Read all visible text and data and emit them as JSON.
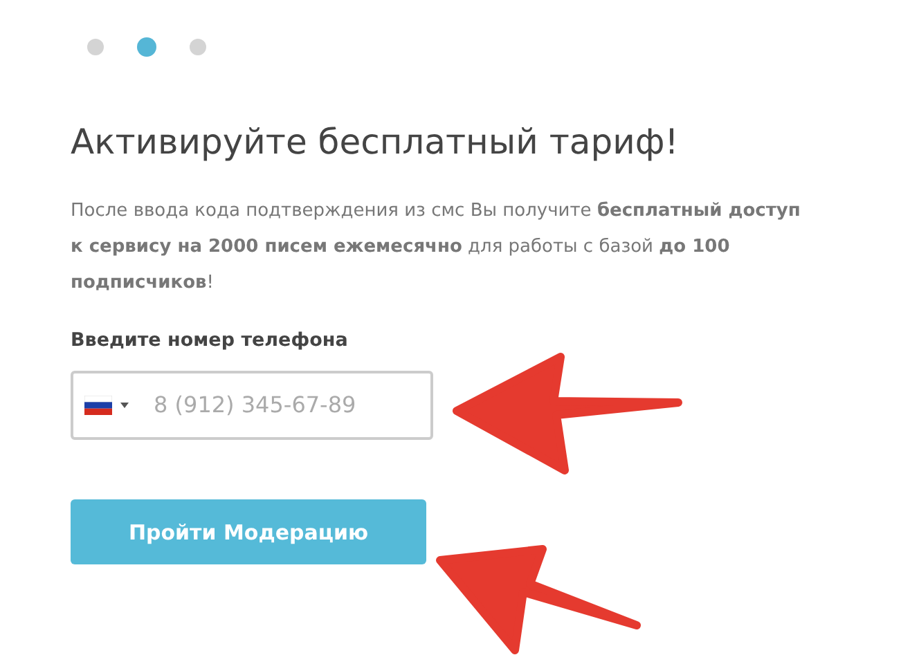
{
  "steps": [
    {
      "selected": false
    },
    {
      "selected": true
    },
    {
      "selected": false
    }
  ],
  "title": "Активируйте бесплатный тариф!",
  "description": "После ввода кода подтверждения из смс Вы получите **бесплатный доступ к сервису на 2000 писем ежемесячно** для работы с базой **до 100 подписчиков**!",
  "phone_field": {
    "label": "Введите номер телефона",
    "placeholder": "8 (912) 345-67-89"
  },
  "button": "Пройти Модерацию"
}
